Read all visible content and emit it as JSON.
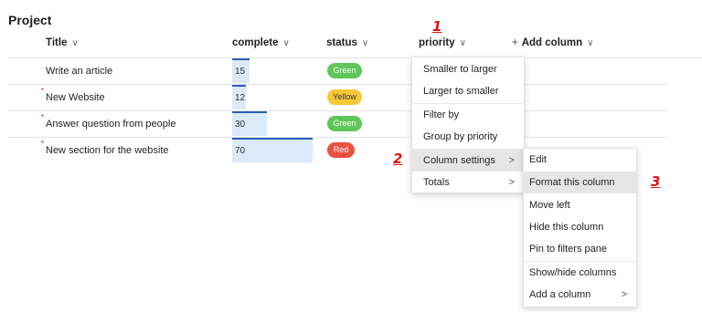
{
  "page": {
    "title": "Project"
  },
  "columns": {
    "title": "Title",
    "complete": "complete",
    "status": "status",
    "priority": "priority",
    "add": "Add column",
    "chevron": "∨",
    "plus": "+"
  },
  "annotations": {
    "one": "1",
    "two": "2",
    "three": "3"
  },
  "rows": [
    {
      "title": "Write an article",
      "complete": "15",
      "complete_pct": 15,
      "status": "Green",
      "status_color": "#5fc65a",
      "is_new": false
    },
    {
      "title": "New Website",
      "complete": "12",
      "complete_pct": 12,
      "status": "Yellow",
      "status_color": "#f9c73a",
      "is_new": true
    },
    {
      "title": "Answer question from people",
      "complete": "30",
      "complete_pct": 30,
      "status": "Green",
      "status_color": "#5fc65a",
      "is_new": true
    },
    {
      "title": "New section for the website",
      "complete": "70",
      "complete_pct": 70,
      "status": "Red",
      "status_color": "#e8513f",
      "is_new": true
    }
  ],
  "new_marker": "*",
  "priority_menu": {
    "items": [
      "Smaller to larger",
      "Larger to smaller",
      "Filter by",
      "Group by priority",
      "Column settings",
      "Totals"
    ],
    "arrow": ">"
  },
  "column_settings_menu": {
    "items": [
      "Edit",
      "Format this column",
      "Move left",
      "Hide this column",
      "Pin to filters pane",
      "Show/hide columns",
      "Add a column"
    ],
    "arrow": ">"
  },
  "colors": {
    "bar_fill": "#dbeaf8",
    "bar_accent": "#2b5eb5",
    "annotation": "#dd1111"
  }
}
